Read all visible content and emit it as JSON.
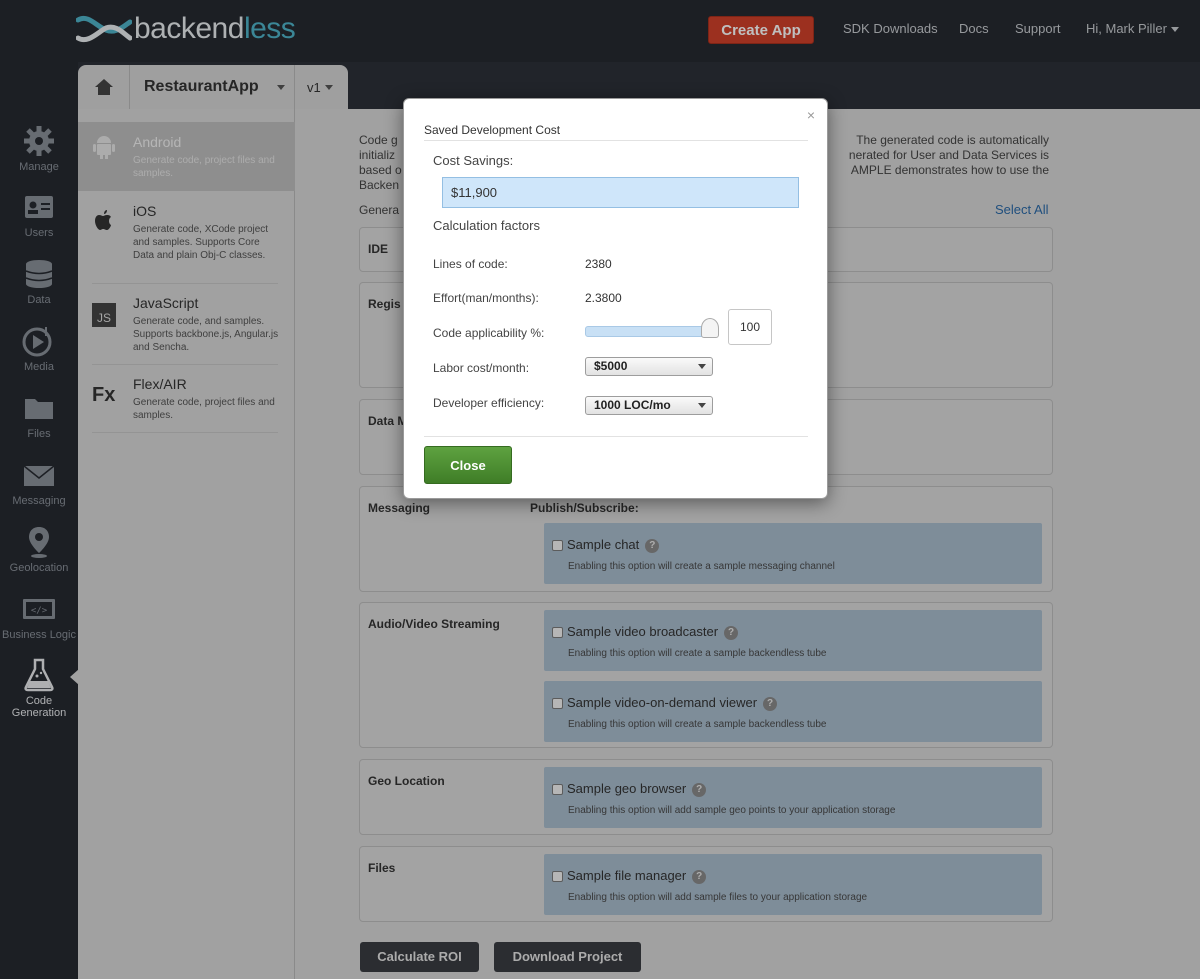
{
  "brand": {
    "name_part1": "backend",
    "name_part2": "less"
  },
  "topnav": {
    "create_app": "Create App",
    "sdk_downloads": "SDK Downloads",
    "docs": "Docs",
    "support": "Support",
    "user": "Hi, Mark Piller"
  },
  "sidebar": {
    "items": [
      {
        "label": "Manage",
        "icon": "gear-icon"
      },
      {
        "label": "Users",
        "icon": "users-icon"
      },
      {
        "label": "Data",
        "icon": "database-icon"
      },
      {
        "label": "Media",
        "icon": "media-icon"
      },
      {
        "label": "Files",
        "icon": "folder-icon"
      },
      {
        "label": "Messaging",
        "icon": "envelope-icon"
      },
      {
        "label": "Geolocation",
        "icon": "map-pin-icon"
      },
      {
        "label": "Business Logic",
        "icon": "code-icon"
      },
      {
        "label": "Code Generation",
        "icon": "flask-icon"
      }
    ]
  },
  "app_header": {
    "app_name": "RestaurantApp",
    "version": "v1"
  },
  "platforms": [
    {
      "name": "Android",
      "desc": "Generate code, project files and samples.",
      "active": true
    },
    {
      "name": "iOS",
      "desc": "Generate code, XCode project and samples. Supports Core Data and plain Obj-C classes.",
      "active": false
    },
    {
      "name": "JavaScript",
      "desc": "Generate code, and samples. Supports backbone.js, Angular.js and Sencha.",
      "active": false
    },
    {
      "name": "Flex/AIR",
      "desc": "Generate code, project files and samples.",
      "active": false
    }
  ],
  "main": {
    "intro_left": "Code g\ninitializ\nbased o\nBacken",
    "intro_right": "The generated code is automatically\nnerated for User and Data Services is\nAMPLE demonstrates how to use the",
    "gen_label": "Genera",
    "select_all": "Select All",
    "sections": {
      "ide": "IDE",
      "regis": "Regis",
      "data": "Data M",
      "messaging": "Messaging",
      "audio_video": "Audio/Video Streaming",
      "geo": "Geo Location",
      "files": "Files"
    },
    "publish_subscribe": "Publish/Subscribe:",
    "options": {
      "chat": {
        "label": "Sample chat",
        "desc": "Enabling this option will create a sample messaging channel"
      },
      "broadcaster": {
        "label": "Sample video broadcaster",
        "desc": "Enabling this option will create a sample backendless tube"
      },
      "vod": {
        "label": "Sample video-on-demand viewer",
        "desc": "Enabling this option will create a sample backendless tube"
      },
      "geo": {
        "label": "Sample geo browser",
        "desc": "Enabling this option will add sample geo points to your application storage"
      },
      "filemgr": {
        "label": "Sample file manager",
        "desc": "Enabling this option will add sample files to your application storage"
      }
    },
    "buttons": {
      "calculate_roi": "Calculate ROI",
      "download_project": "Download Project"
    }
  },
  "modal": {
    "title": "Saved Development Cost",
    "close_x": "×",
    "cost_savings_label": "Cost Savings:",
    "cost_savings_value": "$11,900",
    "factors_label": "Calculation factors",
    "lines_of_code_label": "Lines of code:",
    "lines_of_code_value": "2380",
    "effort_label": "Effort(man/months):",
    "effort_value": "2.3800",
    "applicability_label": "Code applicability %:",
    "applicability_value": "100",
    "labor_label": "Labor cost/month:",
    "labor_value": "$5000",
    "efficiency_label": "Developer efficiency:",
    "efficiency_value": "1000 LOC/mo",
    "close_button": "Close"
  },
  "colors": {
    "accent_red": "#d0402a",
    "close_green": "#4c8f31",
    "link_blue": "#2b6aa8",
    "brand_teal": "#4fb3c8"
  }
}
